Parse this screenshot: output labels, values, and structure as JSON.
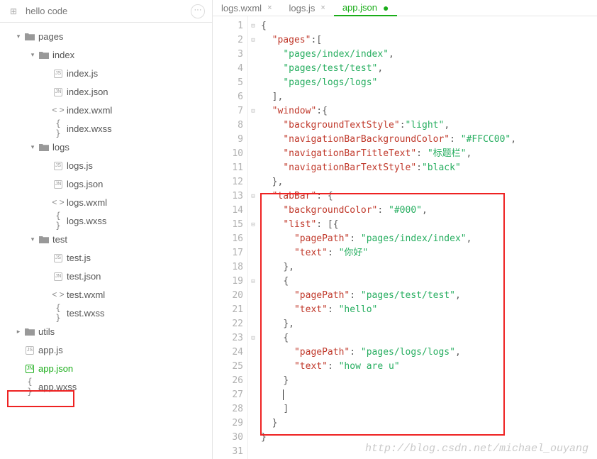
{
  "sidebar": {
    "title": "hello code",
    "root": {
      "pages": "pages",
      "index": {
        "folder": "index",
        "js": "index.js",
        "json": "index.json",
        "wxml": "index.wxml",
        "wxss": "index.wxss"
      },
      "logs": {
        "folder": "logs",
        "js": "logs.js",
        "json": "logs.json",
        "wxml": "logs.wxml",
        "wxss": "logs.wxss"
      },
      "test": {
        "folder": "test",
        "js": "test.js",
        "json": "test.json",
        "wxml": "test.wxml",
        "wxss": "test.wxss"
      },
      "utils": "utils",
      "app_js": "app.js",
      "app_json": "app.json",
      "app_wxss": "app.wxss"
    }
  },
  "tabs": {
    "t1": "logs.wxml",
    "t2": "logs.js",
    "t3": "app.json"
  },
  "code": {
    "lines": {
      "1": "1",
      "2": "2",
      "3": "3",
      "4": "4",
      "5": "5",
      "6": "6",
      "7": "7",
      "8": "8",
      "9": "9",
      "10": "10",
      "11": "11",
      "12": "12",
      "13": "13",
      "14": "14",
      "15": "15",
      "16": "16",
      "17": "17",
      "18": "18",
      "19": "19",
      "20": "20",
      "21": "21",
      "22": "22",
      "23": "23",
      "24": "24",
      "25": "25",
      "26": "26",
      "27": "27",
      "28": "28",
      "29": "29",
      "30": "30",
      "31": "31"
    },
    "k_pages": "\"pages\"",
    "v_pages_1": "\"pages/index/index\"",
    "v_pages_2": "\"pages/test/test\"",
    "v_pages_3": "\"pages/logs/logs\"",
    "k_window": "\"window\"",
    "k_bts": "\"backgroundTextStyle\"",
    "v_bts": "\"light\"",
    "k_nbc": "\"navigationBarBackgroundColor\"",
    "v_nbc": "\"#FFCC00\"",
    "k_nbtt": "\"navigationBarTitleText\"",
    "v_nbtt": "\"标题栏\"",
    "k_nbts": "\"navigationBarTextStyle\"",
    "v_nbts": "\"black\"",
    "k_tabbar": "\"tabBar\"",
    "k_bgcolor": "\"backgroundColor\"",
    "v_bgcolor": "\"#000\"",
    "k_list": "\"list\"",
    "k_pagepath": "\"pagePath\"",
    "v_pp1": "\"pages/index/index\"",
    "k_text": "\"text\"",
    "v_t1": "\"你好\"",
    "v_pp2": "\"pages/test/test\"",
    "v_t2": "\"hello\"",
    "v_pp3": "\"pages/logs/logs\"",
    "v_t3": "\"how are u\""
  },
  "watermark": "http://blog.csdn.net/michael_ouyang"
}
